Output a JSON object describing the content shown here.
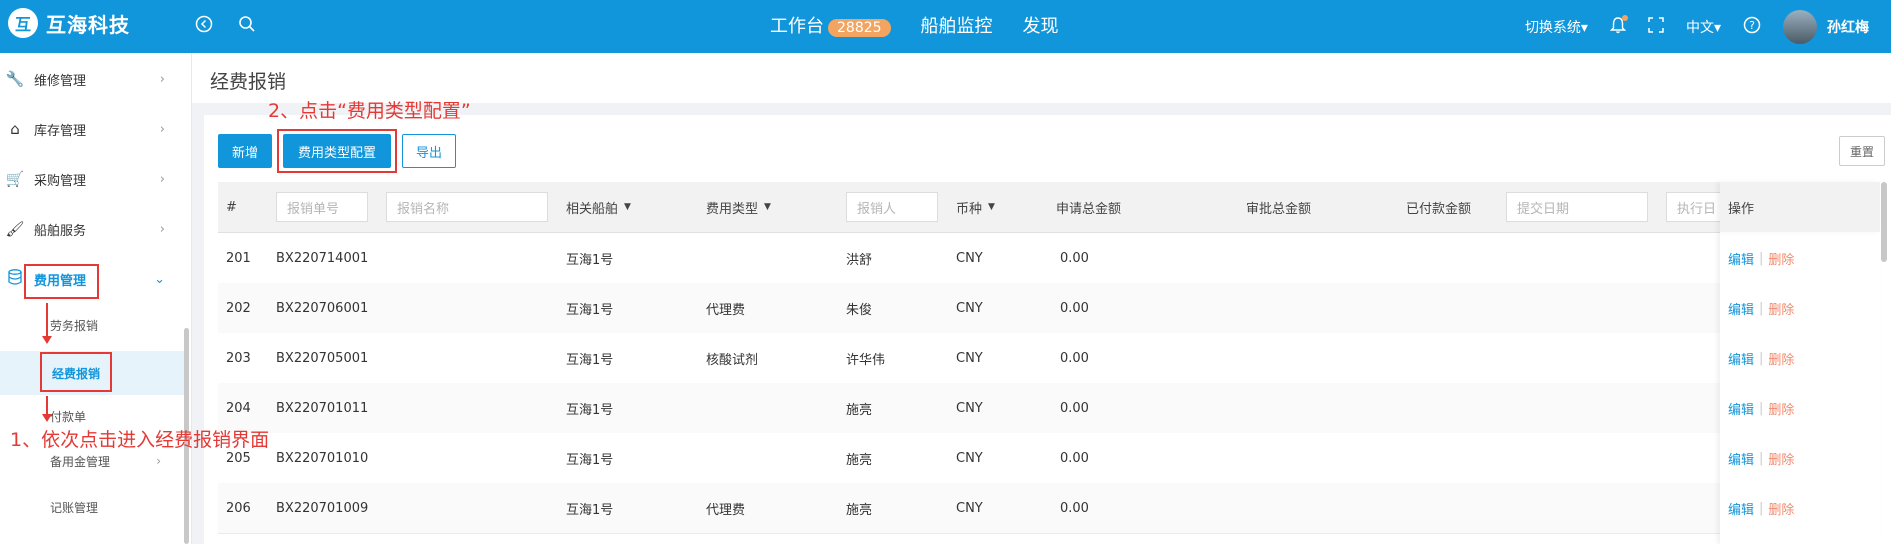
{
  "app": {
    "logo_mark": "互",
    "name": "互海科技"
  },
  "header": {
    "nav": [
      {
        "label": "工作台",
        "badge": "28825"
      },
      {
        "label": "船舶监控"
      },
      {
        "label": "发现"
      }
    ],
    "switch_system": "切换系统▾",
    "language": "中文▾",
    "user": "孙红梅",
    "icons": [
      "back-icon",
      "search-icon",
      "bell-icon",
      "fullscreen-icon",
      "help-icon"
    ]
  },
  "sidebar": {
    "items": [
      {
        "label": "维修管理",
        "icon": "wrench-icon"
      },
      {
        "label": "库存管理",
        "icon": "home-icon"
      },
      {
        "label": "采购管理",
        "icon": "cart-icon"
      },
      {
        "label": "船舶服务",
        "icon": "paint-roller-icon"
      },
      {
        "label": "费用管理",
        "icon": "database-icon"
      }
    ],
    "subitems": [
      {
        "label": "劳务报销"
      },
      {
        "label": "经费报销"
      },
      {
        "label": "付款单"
      },
      {
        "label": "备用金管理"
      },
      {
        "label": "记账管理"
      }
    ]
  },
  "page": {
    "title": "经费报销"
  },
  "toolbar": {
    "add": "新增",
    "fee_type_config": "费用类型配置",
    "export": "导出",
    "reset": "重置"
  },
  "annotations": {
    "step1": "1、依次点击进入经费报销界面",
    "step2": "2、点击“费用类型配置”"
  },
  "table": {
    "headers": {
      "index": "#",
      "bill_no_placeholder": "报销单号",
      "bill_name_placeholder": "报销名称",
      "ship": "相关船舶",
      "fee_type": "费用类型",
      "claimant_placeholder": "报销人",
      "currency": "币种",
      "applied_total": "申请总金额",
      "approved_total": "审批总金额",
      "paid_amount": "已付款金额",
      "submit_date_placeholder": "提交日期",
      "exec_date_placeholder": "执行日",
      "actions": "操作"
    },
    "rows": [
      {
        "index": "201",
        "bill_no": "BX220714001",
        "ship": "互海1号",
        "fee_type": "",
        "claimant": "洪舒",
        "currency": "CNY",
        "applied": "0.00",
        "edit": "编辑",
        "sep": "|",
        "delete": "删除"
      },
      {
        "index": "202",
        "bill_no": "BX220706001",
        "ship": "互海1号",
        "fee_type": "代理费",
        "claimant": "朱俊",
        "currency": "CNY",
        "applied": "0.00",
        "edit": "编辑",
        "sep": "|",
        "delete": "删除"
      },
      {
        "index": "203",
        "bill_no": "BX220705001",
        "ship": "互海1号",
        "fee_type": "核酸试剂",
        "claimant": "许华伟",
        "currency": "CNY",
        "applied": "0.00",
        "edit": "编辑",
        "sep": "|",
        "delete": "删除"
      },
      {
        "index": "204",
        "bill_no": "BX220701011",
        "ship": "互海1号",
        "fee_type": "",
        "claimant": "施亮",
        "currency": "CNY",
        "applied": "0.00",
        "edit": "编辑",
        "sep": "|",
        "delete": "删除"
      },
      {
        "index": "205",
        "bill_no": "BX220701010",
        "ship": "互海1号",
        "fee_type": "",
        "claimant": "施亮",
        "currency": "CNY",
        "applied": "0.00",
        "edit": "编辑",
        "sep": "|",
        "delete": "删除"
      },
      {
        "index": "206",
        "bill_no": "BX220701009",
        "ship": "互海1号",
        "fee_type": "代理费",
        "claimant": "施亮",
        "currency": "CNY",
        "applied": "0.00",
        "edit": "编辑",
        "sep": "|",
        "delete": "删除"
      }
    ]
  },
  "colors": {
    "primary": "#1296db",
    "annotation": "#e53935",
    "delete": "#f08a6c",
    "badge": "#f4a461"
  }
}
